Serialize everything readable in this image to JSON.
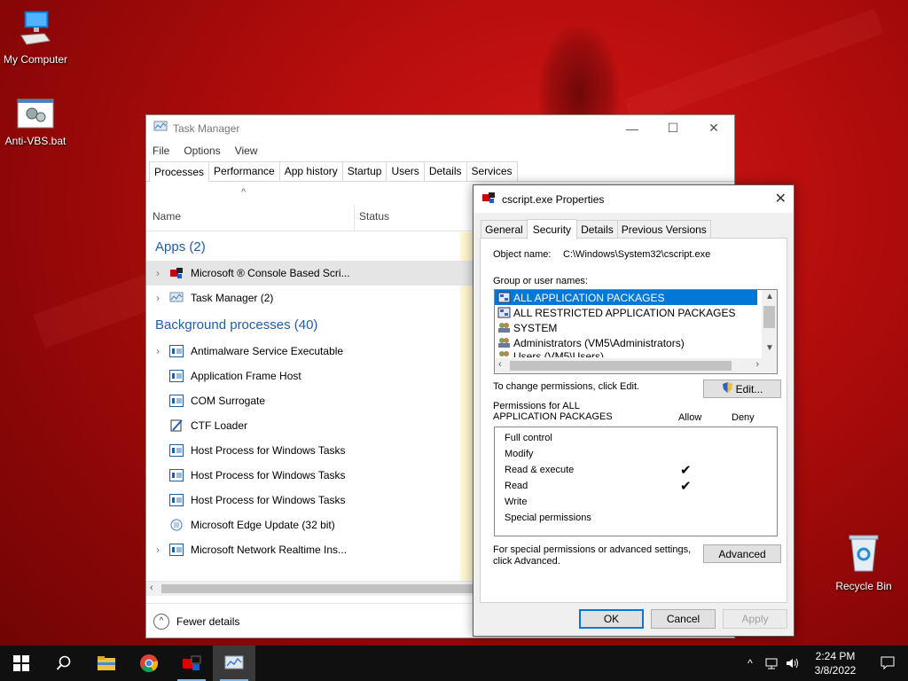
{
  "desktop": {
    "icons": [
      {
        "label": "My Computer",
        "icon": "monitor-icon"
      },
      {
        "label": "Anti-VBS.bat",
        "icon": "batch-file-icon"
      },
      {
        "label": "Recycle Bin",
        "icon": "recycle-bin-icon"
      }
    ]
  },
  "task_manager": {
    "title": "Task Manager",
    "menu": [
      "File",
      "Options",
      "View"
    ],
    "tabs": [
      "Processes",
      "Performance",
      "App history",
      "Startup",
      "Users",
      "Details",
      "Services"
    ],
    "columns": {
      "name": "Name",
      "status": "Status"
    },
    "apps_group": "Apps (2)",
    "apps": [
      {
        "name": "Microsoft ® Console Based Scri..."
      },
      {
        "name": "Task Manager (2)"
      }
    ],
    "bg_group": "Background processes (40)",
    "background": [
      {
        "name": "Antimalware Service Executable",
        "expandable": true
      },
      {
        "name": "Application Frame Host",
        "expandable": false
      },
      {
        "name": "COM Surrogate",
        "expandable": false
      },
      {
        "name": "CTF Loader",
        "expandable": false
      },
      {
        "name": "Host Process for Windows Tasks",
        "expandable": false
      },
      {
        "name": "Host Process for Windows Tasks",
        "expandable": false
      },
      {
        "name": "Host Process for Windows Tasks",
        "expandable": false
      },
      {
        "name": "Microsoft Edge Update (32 bit)",
        "expandable": false
      },
      {
        "name": "Microsoft Network Realtime Ins...",
        "expandable": true
      }
    ],
    "fewer_details": "Fewer details"
  },
  "properties": {
    "title": "cscript.exe Properties",
    "tabs": [
      "General",
      "Security",
      "Details",
      "Previous Versions"
    ],
    "object_name_label": "Object name:",
    "object_name_value": "C:\\Windows\\System32\\cscript.exe",
    "group_label": "Group or user names:",
    "groups": [
      "ALL APPLICATION PACKAGES",
      "ALL RESTRICTED APPLICATION PACKAGES",
      "SYSTEM",
      "Administrators (VM5\\Administrators)",
      "Users (VM5\\Users)"
    ],
    "change_label": "To change permissions, click Edit.",
    "edit_button": "Edit...",
    "permissions_label_1": "Permissions for ALL",
    "permissions_label_2": "APPLICATION PACKAGES",
    "allow_label": "Allow",
    "deny_label": "Deny",
    "permissions": [
      {
        "name": "Full control",
        "allow": false,
        "deny": false
      },
      {
        "name": "Modify",
        "allow": false,
        "deny": false
      },
      {
        "name": "Read & execute",
        "allow": true,
        "deny": false
      },
      {
        "name": "Read",
        "allow": true,
        "deny": false
      },
      {
        "name": "Write",
        "allow": false,
        "deny": false
      },
      {
        "name": "Special permissions",
        "allow": false,
        "deny": false
      }
    ],
    "check_mark": "✔",
    "special_label_1": "For special permissions or advanced settings,",
    "special_label_2": "click Advanced.",
    "advanced_button": "Advanced",
    "ok_button": "OK",
    "cancel_button": "Cancel",
    "apply_button": "Apply"
  },
  "taskbar": {
    "time": "2:24 PM",
    "date": "3/8/2022"
  }
}
